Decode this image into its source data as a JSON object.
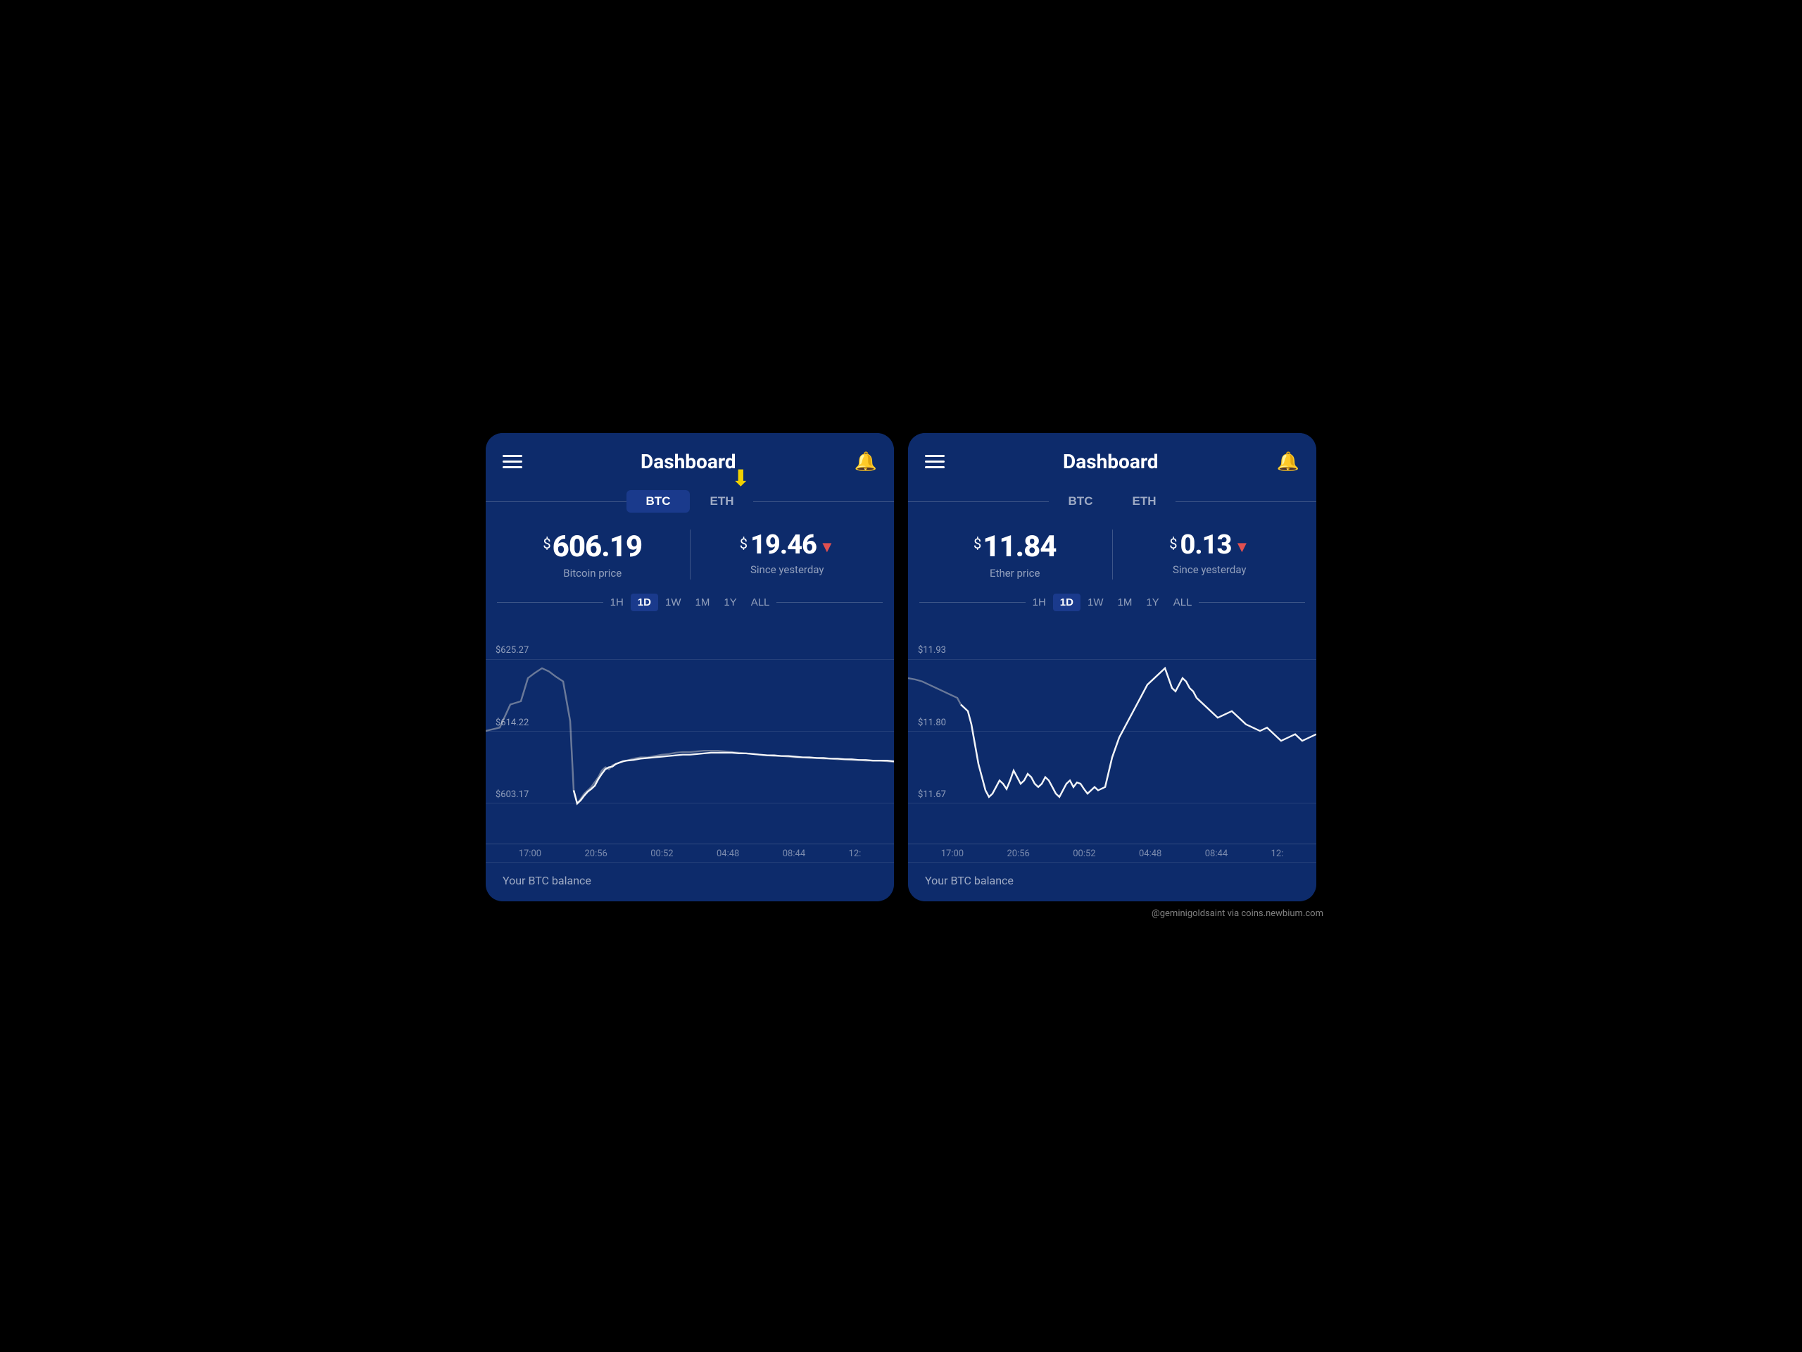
{
  "left_panel": {
    "title": "Dashboard",
    "tabs": [
      {
        "label": "BTC",
        "active": true
      },
      {
        "label": "ETH",
        "active": false
      }
    ],
    "arrow_indicator": true,
    "price": {
      "main_value": "606.19",
      "main_label": "Bitcoin price",
      "change_value": "19.46",
      "change_label": "Since yesterday",
      "change_direction": "down"
    },
    "time_filters": [
      "1H",
      "1D",
      "1W",
      "1M",
      "1Y",
      "ALL"
    ],
    "active_filter": "1D",
    "chart": {
      "y_labels": [
        "$625.27",
        "$614.22",
        "$603.17"
      ],
      "x_labels": [
        "17:00",
        "20:56",
        "00:52",
        "04:48",
        "08:44",
        "12:"
      ]
    },
    "footer": "Your BTC balance"
  },
  "right_panel": {
    "title": "Dashboard",
    "tabs": [
      {
        "label": "BTC",
        "active": false
      },
      {
        "label": "ETH",
        "active": false
      }
    ],
    "price": {
      "main_value": "11.84",
      "main_label": "Ether price",
      "change_value": "0.13",
      "change_label": "Since yesterday",
      "change_direction": "down"
    },
    "time_filters": [
      "1H",
      "1D",
      "1W",
      "1M",
      "1Y",
      "ALL"
    ],
    "active_filter": "1D",
    "chart": {
      "y_labels": [
        "$11.93",
        "$11.80",
        "$11.67"
      ],
      "x_labels": [
        "17:00",
        "20:56",
        "00:52",
        "04:48",
        "08:44",
        "12:"
      ]
    },
    "footer": "Your BTC balance"
  },
  "attribution": "@geminigoldsaint via coins.newbium.com"
}
